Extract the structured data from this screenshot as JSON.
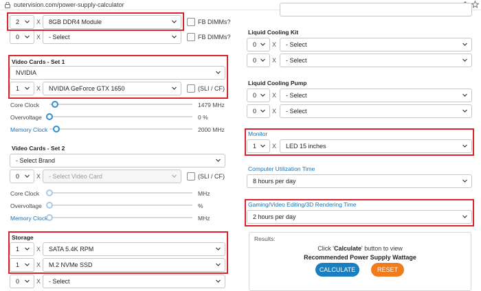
{
  "browser": {
    "url": "outervision.com/power-supply-calculator"
  },
  "memory": {
    "row1": {
      "qty": "2",
      "x": "X",
      "model": "8GB DDR4 Module",
      "fb": "FB DIMMs?"
    },
    "row2": {
      "qty": "0",
      "x": "X",
      "model": "- Select",
      "fb": "FB DIMMs?"
    }
  },
  "video1": {
    "title": "Video Cards - Set 1",
    "brand": "NVIDIA",
    "qty": "1",
    "x": "X",
    "model": "NVIDIA GeForce GTX 1650",
    "sli": "(SLI / CF)",
    "core_clock": {
      "label": "Core Clock",
      "value": "1479 MHz"
    },
    "overvoltage": {
      "label": "Overvoltage",
      "value": "0 %"
    },
    "memory_clock": {
      "label": "Memory Clock",
      "value": "2000 MHz"
    }
  },
  "video2": {
    "title": "Video Cards - Set 2",
    "brand": "- Select Brand",
    "qty": "0",
    "x": "X",
    "model": "- Select Video Card",
    "sli": "(SLI / CF)",
    "core_clock": {
      "label": "Core Clock",
      "value": "MHz"
    },
    "overvoltage": {
      "label": "Overvoltage",
      "value": "%"
    },
    "memory_clock": {
      "label": "Memory Clock",
      "value": "MHz"
    }
  },
  "storage": {
    "title": "Storage",
    "row1": {
      "qty": "1",
      "x": "X",
      "model": "SATA 5.4K RPM"
    },
    "row2": {
      "qty": "1",
      "x": "X",
      "model": "M.2 NVMe SSD"
    },
    "row3": {
      "qty": "0",
      "x": "X",
      "model": "- Select"
    }
  },
  "liquid_kit": {
    "title": "Liquid Cooling Kit",
    "row1": {
      "qty": "0",
      "x": "X",
      "model": "- Select"
    },
    "row2": {
      "qty": "0",
      "x": "X",
      "model": "- Select"
    }
  },
  "liquid_pump": {
    "title": "Liquid Cooling Pump",
    "row1": {
      "qty": "0",
      "x": "X",
      "model": "- Select"
    },
    "row2": {
      "qty": "0",
      "x": "X",
      "model": "- Select"
    }
  },
  "monitor": {
    "title": "Monitor",
    "qty": "1",
    "x": "X",
    "model": "LED 15 inches"
  },
  "utilization": {
    "title": "Computer Utilization Time",
    "value": "8 hours per day"
  },
  "gaming": {
    "title": "Gaming/Video Editing/3D Rendering Time",
    "value": "2 hours per day"
  },
  "results": {
    "label": "Results:",
    "info_prefix": "Click '",
    "info_bold": "Calculate",
    "info_suffix": "' button to view",
    "sub": "Recommended Power Supply Wattage",
    "calculate": "CALCULATE",
    "reset": "RESET"
  },
  "colors": {
    "highlight": "#d9232d",
    "accent": "#1a73b5",
    "calculate": "#1a7fc1",
    "reset": "#f07c1e"
  },
  "icons": [
    "lock-icon",
    "share-icon",
    "star-icon",
    "chevron-down-icon"
  ]
}
